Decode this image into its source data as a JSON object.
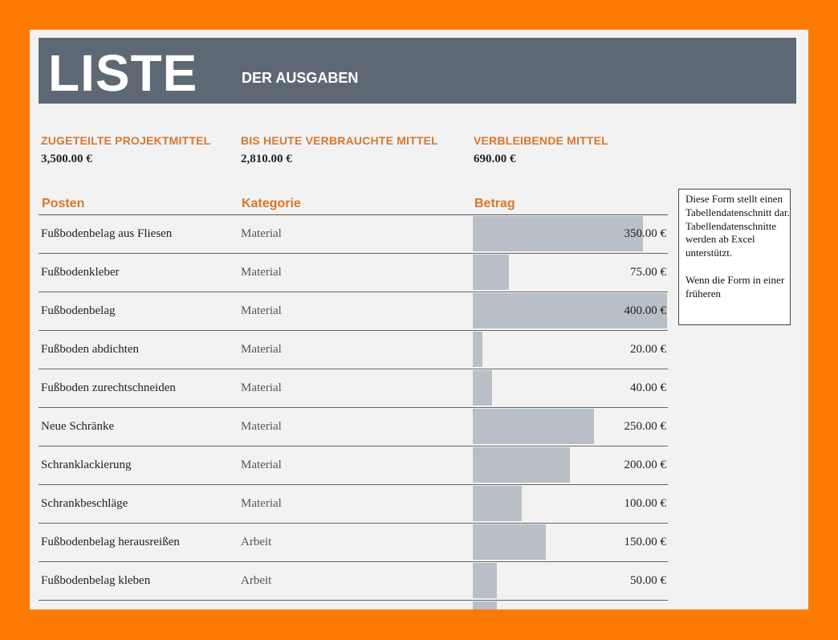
{
  "header": {
    "title": "LISTE",
    "subtitle": "DER AUSGABEN"
  },
  "summary": {
    "allocated": {
      "label": "ZUGETEILTE PROJEKTMITTEL",
      "value": "3,500.00 €"
    },
    "spent": {
      "label": "BIS HEUTE VERBRAUCHTE MITTEL",
      "value": "2,810.00 €"
    },
    "remaining": {
      "label": "VERBLEIBENDE MITTEL",
      "value": "690.00 €"
    }
  },
  "table": {
    "columns": {
      "posten": "Posten",
      "kategorie": "Kategorie",
      "betrag": "Betrag"
    },
    "max_amount": 400,
    "rows": [
      {
        "posten": "Fußbodenbelag aus Fliesen",
        "kategorie": "Material",
        "betrag": "350.00 €",
        "amount": 350
      },
      {
        "posten": "Fußbodenkleber",
        "kategorie": "Material",
        "betrag": "75.00 €",
        "amount": 75
      },
      {
        "posten": "Fußbodenbelag",
        "kategorie": "Material",
        "betrag": "400.00 €",
        "amount": 400
      },
      {
        "posten": "Fußboden abdichten",
        "kategorie": "Material",
        "betrag": "20.00 €",
        "amount": 20
      },
      {
        "posten": "Fußboden zurechtschneiden",
        "kategorie": "Material",
        "betrag": "40.00 €",
        "amount": 40
      },
      {
        "posten": "Neue Schränke",
        "kategorie": "Material",
        "betrag": "250.00 €",
        "amount": 250
      },
      {
        "posten": "Schranklackierung",
        "kategorie": "Material",
        "betrag": "200.00 €",
        "amount": 200
      },
      {
        "posten": "Schrankbeschläge",
        "kategorie": "Material",
        "betrag": "100.00 €",
        "amount": 100
      },
      {
        "posten": "Fußbodenbelag herausreißen",
        "kategorie": "Arbeit",
        "betrag": "150.00 €",
        "amount": 150
      },
      {
        "posten": "Fußbodenbelag kleben",
        "kategorie": "Arbeit",
        "betrag": "50.00 €",
        "amount": 50
      },
      {
        "posten": "",
        "kategorie": "",
        "betrag": "",
        "amount": 50
      }
    ]
  },
  "note": {
    "line1": "Diese Form stellt einen Tabellendatenschnitt dar. Tabellendatenschnitte werden ab Excel unterstützt.",
    "line2": "Wenn die Form in einer früheren"
  },
  "colors": {
    "frame": "#ff7a00",
    "banner": "#5e6874",
    "accent": "#d9772b",
    "bar": "#b8bfc6"
  }
}
